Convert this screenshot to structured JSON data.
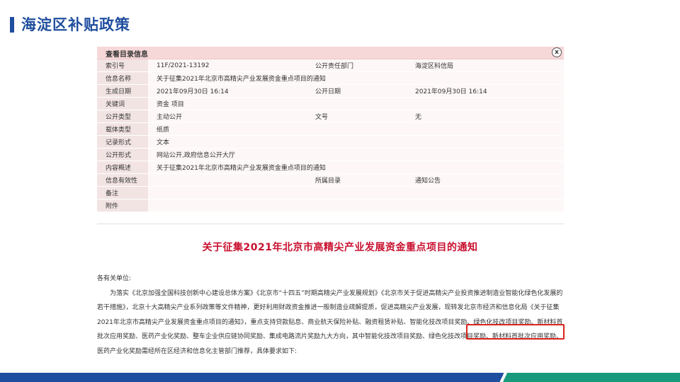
{
  "slide": {
    "title": "海淀区补贴政策"
  },
  "panel": {
    "header_title": "查看目录信息",
    "close_glyph": "x",
    "rows": [
      {
        "label": "索引号",
        "value": "11F/2021-13192",
        "label2": "公开责任部门",
        "value2": "海淀区科信局"
      },
      {
        "label": "信息名称",
        "value": "关于征集2021年北京市高精尖产业发展资金重点项目的通知",
        "label2": "",
        "value2": ""
      },
      {
        "label": "生成日期",
        "value": "2021年09月30日 16:14",
        "label2": "公开日期",
        "value2": "2021年09月30日 16:14"
      },
      {
        "label": "关键词",
        "value": "资金 项目",
        "label2": "",
        "value2": ""
      },
      {
        "label": "公开类型",
        "value": "主动公开",
        "label2": "文号",
        "value2": "无"
      },
      {
        "label": "载体类型",
        "value": "纸质",
        "label2": "",
        "value2": ""
      },
      {
        "label": "记录形式",
        "value": "文本",
        "label2": "",
        "value2": ""
      },
      {
        "label": "公开形式",
        "value": "网站公开,政府信息公开大厅",
        "label2": "",
        "value2": ""
      },
      {
        "label": "内容概述",
        "value": "关于征集2021年北京市高精尖产业发展资金重点项目的通知",
        "label2": "",
        "value2": ""
      },
      {
        "label": "信息有效性",
        "value": "",
        "label2": "所属目录",
        "value2": "通知公告"
      },
      {
        "label": "备注",
        "value": "",
        "label2": "",
        "value2": ""
      },
      {
        "label": "附件",
        "value": "",
        "label2": "",
        "value2": ""
      }
    ]
  },
  "document": {
    "title": "关于征集2021年北京市高精尖产业发展资金重点项目的通知",
    "salutation": "各有关单位:",
    "paragraph": "为落实《北京加强全国科技创新中心建设总体方案》《北京市“十四五”时期高精尖产业发展规划》《北京市关于促进高精尖产业投资推进制造业智能化绿色化发展的若干措施》，北京十大高精尖产业系列政策等文件精神，更好利用财政资金推进一般制造业疏解提质，促进高精尖产业发展，现转发北京市经济和信息化局《关于征集2021年北京市高精尖产业发展资金重点项目的通知》，重点支持贷款贴息、商业航天保险补贴、融资租赁补贴、智能化技改项目奖励、绿色化技改项目奖励、新材料首批次应用奖励、医药产业化奖励、整车企业供应链协同奖励、集成电路流片奖励九大方向，其中智能化技改项目奖励、绿色化技改项目奖励、新材料首批次应用奖励、医药产业化奖励需经所在区经济和信息化主管部门推荐，具体要求如下:"
  },
  "colors": {
    "brand_blue": "#1f4e9e",
    "accent_green": "#1a9a7d",
    "highlight_red": "#d9251d",
    "doc_title_red": "#c8102e"
  }
}
